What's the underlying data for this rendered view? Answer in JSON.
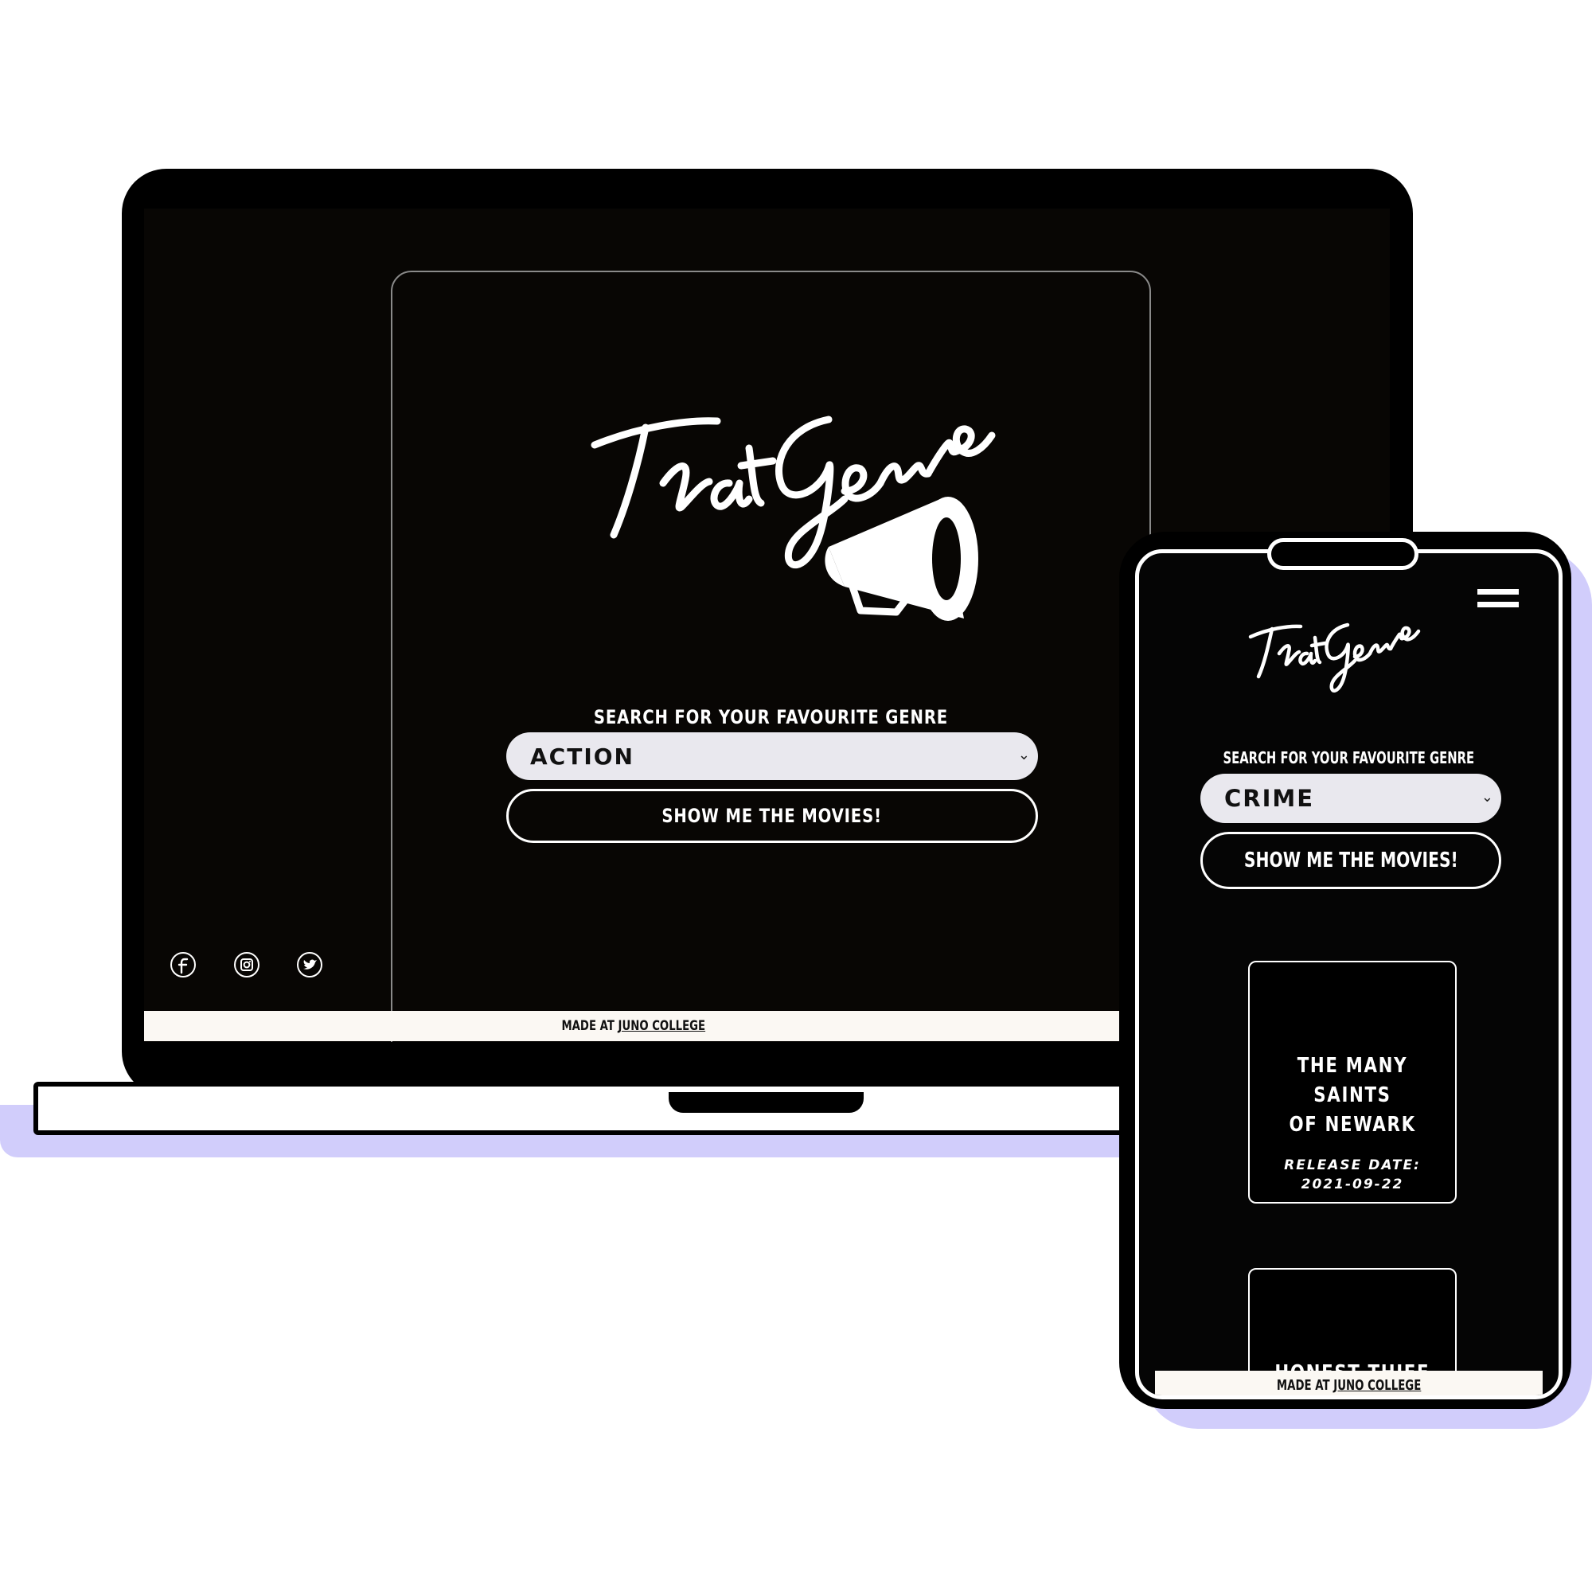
{
  "brand": {
    "logo_text": "ThatGenre"
  },
  "search": {
    "label": "SEARCH FOR YOUR FAVOURITE GENRE",
    "button_label": "SHOW ME THE MOVIES!"
  },
  "desktop": {
    "selected_genre": "ACTION",
    "social_icons": [
      "facebook-icon",
      "instagram-icon",
      "twitter-icon"
    ]
  },
  "mobile": {
    "selected_genre": "CRIME",
    "movies": [
      {
        "title_line1": "THE MANY SAINTS",
        "title_line2": "OF NEWARK",
        "release_label": "RELEASE DATE:",
        "release_date": "2021-09-22"
      },
      {
        "title_line1": "HONEST THIEF"
      }
    ]
  },
  "footer": {
    "prefix": "MADE AT",
    "link_text": "JUNO COLLEGE"
  },
  "colors": {
    "background": "#ffffff",
    "screen_bg": "#080604",
    "select_bg": "#e9e8ee",
    "accent_shadow": "#d1cdfb",
    "footer_bg": "#fbf8f3"
  }
}
